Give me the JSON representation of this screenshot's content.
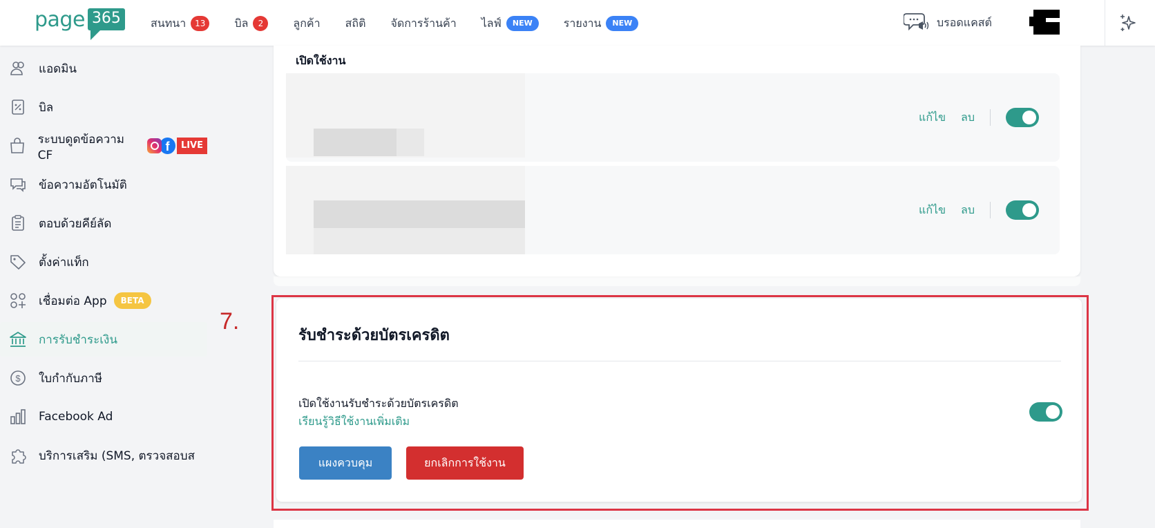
{
  "header": {
    "logo_text": "page",
    "logo_badge": "365",
    "nav": [
      {
        "label": "สนทนา",
        "badge": "13",
        "badge_type": "count"
      },
      {
        "label": "บิล",
        "badge": "2",
        "badge_type": "count"
      },
      {
        "label": "ลูกค้า"
      },
      {
        "label": "สถิติ"
      },
      {
        "label": "จัดการร้านค้า"
      },
      {
        "label": "ไลฟ์",
        "badge": "NEW",
        "badge_type": "new"
      },
      {
        "label": "รายงาน",
        "badge": "NEW",
        "badge_type": "new"
      }
    ],
    "broadcast_label": "บรอดแคสต์",
    "broadcast_icon": "megaphone-chat-icon",
    "sparkle_icon": "sparkle-icon"
  },
  "sidebar": {
    "items": [
      {
        "label": "แอดมิน",
        "icon": "users-icon"
      },
      {
        "label": "บิล",
        "icon": "receipt-percent-icon"
      },
      {
        "label": "ระบบดูดข้อความ CF",
        "icon": "shopping-bag-icon",
        "live_badge": "LIVE"
      },
      {
        "label": "ข้อความอัตโนมัติ",
        "icon": "chat-bubbles-icon"
      },
      {
        "label": "ตอบด้วยคีย์ลัด",
        "icon": "clipboard-list-icon"
      },
      {
        "label": "ตั้งค่าแท็ก",
        "icon": "tag-icon"
      },
      {
        "label": "เชื่อมต่อ App",
        "icon": "apps-grid-icon",
        "badge": "BETA"
      },
      {
        "label": "การรับชำระเงิน",
        "icon": "bank-icon",
        "active": true
      },
      {
        "label": "ใบกำกับภาษี",
        "icon": "dollar-circle-icon"
      },
      {
        "label": "Facebook Ad",
        "icon": "bar-chart-icon"
      },
      {
        "label": "บริการเสริม (SMS, ตรวจสอบส",
        "icon": "puzzle-icon"
      }
    ]
  },
  "main": {
    "enable_title": "เปิดใช้งาน",
    "rows": [
      {
        "edit_label": "แก้ไข",
        "delete_label": "ลบ",
        "enabled": true
      },
      {
        "edit_label": "แก้ไข",
        "delete_label": "ลบ",
        "enabled": true
      }
    ],
    "step_number": "7.",
    "credit_card": {
      "title": "รับชำระด้วยบัตรเครดิต",
      "enable_label": "เปิดใช้งานรับชำระด้วยบัตรเครดิต",
      "learn_more": "เรียนรู้วิธีใช้งานเพิ่มเติม",
      "enabled": true,
      "dashboard_button": "แผงควบคุม",
      "cancel_button": "ยกเลิกการใช้งาน"
    }
  },
  "colors": {
    "brand": "#2e9a8b",
    "badge_red": "#e53935",
    "badge_new": "#3b82f6",
    "button_blue": "#3b82c4",
    "button_red": "#d32f2f",
    "highlight": "#dc3545"
  }
}
